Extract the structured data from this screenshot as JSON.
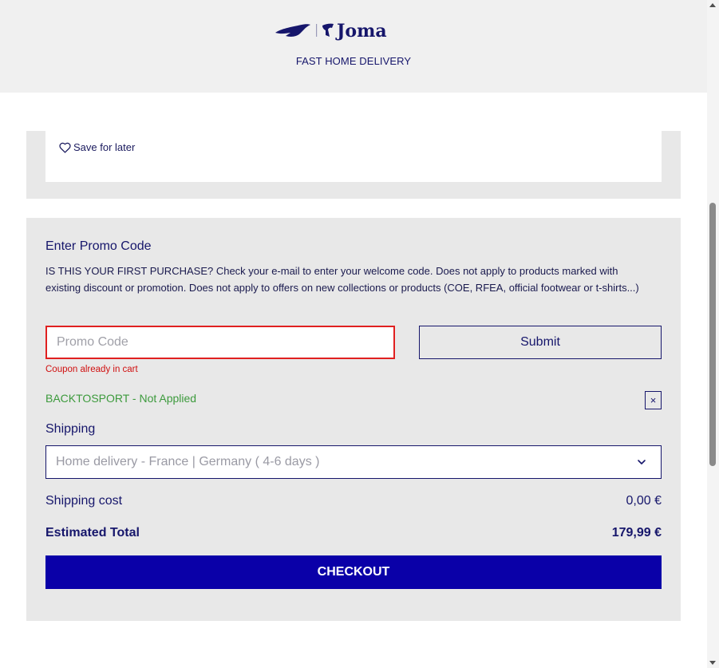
{
  "header": {
    "logo_text": "Joma",
    "delivery_banner": "FAST HOME DELIVERY"
  },
  "cart_item": {
    "save_for_later": "Save for later"
  },
  "promo": {
    "title": "Enter Promo Code",
    "description": "IS THIS YOUR FIRST PURCHASE? Check your e-mail to enter your welcome code. Does not apply to products marked with existing discount or promotion. Does not apply to offers on new collections or products (COE, RFEA, official footwear or t-shirts...)",
    "input_placeholder": "Promo Code",
    "input_value": "",
    "submit_label": "Submit",
    "error_message": "Coupon already in cart",
    "applied_coupon_status": "BACKTOSPORT - Not Applied",
    "remove_label": "×"
  },
  "shipping": {
    "label": "Shipping",
    "selected_option": "Home delivery - France | Germany ( 4-6 days )"
  },
  "totals": {
    "shipping_cost_label": "Shipping cost",
    "shipping_cost_value": "0,00 €",
    "estimated_total_label": "Estimated Total",
    "estimated_total_value": "179,99 €"
  },
  "checkout": {
    "label": "CHECKOUT"
  },
  "colors": {
    "brand_navy": "#16166b",
    "checkout_blue": "#0a00a8",
    "error_red": "#e02020",
    "status_green": "#3c9a3c",
    "panel_grey": "#e8e8e8"
  },
  "icons": {
    "save_for_later": "heart-outline-icon",
    "shipping_select": "chevron-down-icon",
    "remove_coupon": "close-icon"
  }
}
